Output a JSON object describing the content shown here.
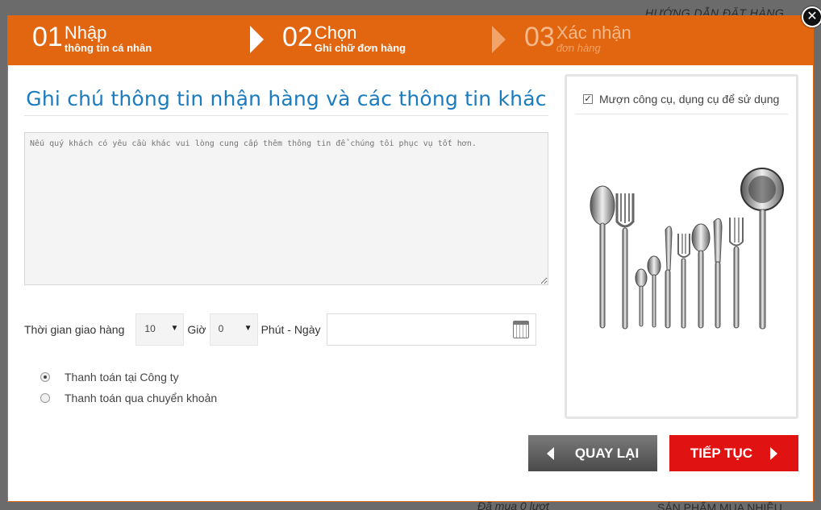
{
  "backdrop": {
    "top_text": "HƯỚNG DẪN ĐẶT HÀNG",
    "bottom_left": "Đã mua 0 lượt",
    "bottom_right": "SẢN PHẨM MUA NHIỀU"
  },
  "steps": [
    {
      "num": "01",
      "title": "Nhập",
      "subtitle": "thông tin cá nhân",
      "active": true
    },
    {
      "num": "02",
      "title": "Chọn",
      "subtitle": "Ghi chữ đơn hàng",
      "active": true
    },
    {
      "num": "03",
      "title": "Xác nhận",
      "subtitle": "đơn hàng",
      "active": false
    }
  ],
  "close_label": "✕",
  "notes": {
    "title": "Ghi chú thông tin nhận hàng và các thông tin khác",
    "placeholder": "Nếu quý khách có yêu cầu khác vui lòng cung cấp thêm thông tin để chúng tôi phục vụ tốt hơn."
  },
  "delivery": {
    "label": "Thời gian giao hàng",
    "hour_value": "10",
    "hour_unit": "Giờ",
    "minute_value": "0",
    "minute_unit": "Phút - Ngày",
    "date_value": ""
  },
  "payment": {
    "options": [
      {
        "label": "Thanh toán tại Công ty",
        "checked": true
      },
      {
        "label": "Thanh toán qua chuyển khoản",
        "checked": false
      }
    ]
  },
  "tools": {
    "label": "Mượn công cụ, dụng cụ để sử dụng",
    "checked": true,
    "image": "cutlery-set"
  },
  "buttons": {
    "back": "QUAY LẠI",
    "next": "TIẾP TỤC"
  },
  "colors": {
    "header": "#e2650f",
    "title": "#1a7bbf",
    "next_button": "#e01212",
    "back_button": "#5a5a5a"
  }
}
